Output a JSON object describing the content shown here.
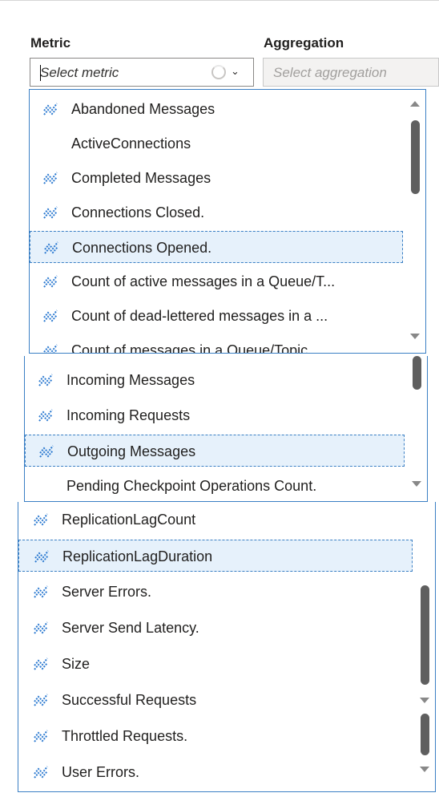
{
  "form": {
    "metric_label": "Metric",
    "aggregation_label": "Aggregation",
    "metric_placeholder": "Select metric",
    "aggregation_placeholder": "Select aggregation"
  },
  "panel1": {
    "items": [
      {
        "label": "Abandoned Messages",
        "icon": "metric-icon"
      },
      {
        "label": "ActiveConnections",
        "icon": ""
      },
      {
        "label": "Completed Messages",
        "icon": "metric-icon"
      },
      {
        "label": "Connections Closed.",
        "icon": "metric-icon"
      },
      {
        "label": "Connections Opened.",
        "icon": "metric-icon",
        "selected": true
      },
      {
        "label": "Count of active messages in a Queue/T...",
        "icon": "metric-icon"
      },
      {
        "label": "Count of dead-lettered messages in a ...",
        "icon": "metric-icon"
      },
      {
        "label": "Count of messages in a Queue/Topic",
        "icon": "metric-icon"
      }
    ]
  },
  "panel2": {
    "items": [
      {
        "label": "Incoming Messages",
        "icon": "metric-icon"
      },
      {
        "label": "Incoming Requests",
        "icon": "metric-icon"
      },
      {
        "label": "Outgoing Messages",
        "icon": "metric-icon",
        "selected": true
      },
      {
        "label": "Pending Checkpoint Operations Count.",
        "icon": ""
      }
    ]
  },
  "panel3": {
    "items": [
      {
        "label": "ReplicationLagCount",
        "icon": "metric-icon"
      },
      {
        "label": "ReplicationLagDuration",
        "icon": "metric-icon",
        "selected": true
      },
      {
        "label": "Server Errors.",
        "icon": "metric-icon"
      },
      {
        "label": "Server Send Latency.",
        "icon": "metric-icon"
      },
      {
        "label": "Size",
        "icon": "metric-icon"
      },
      {
        "label": "Successful Requests",
        "icon": "metric-icon"
      },
      {
        "label": "Throttled Requests.",
        "icon": "metric-icon"
      },
      {
        "label": "User Errors.",
        "icon": "metric-icon"
      }
    ]
  },
  "colors": {
    "accent": "#3a7fc4",
    "icon": "#2b79d0",
    "selected_bg": "#e6f1fb"
  }
}
